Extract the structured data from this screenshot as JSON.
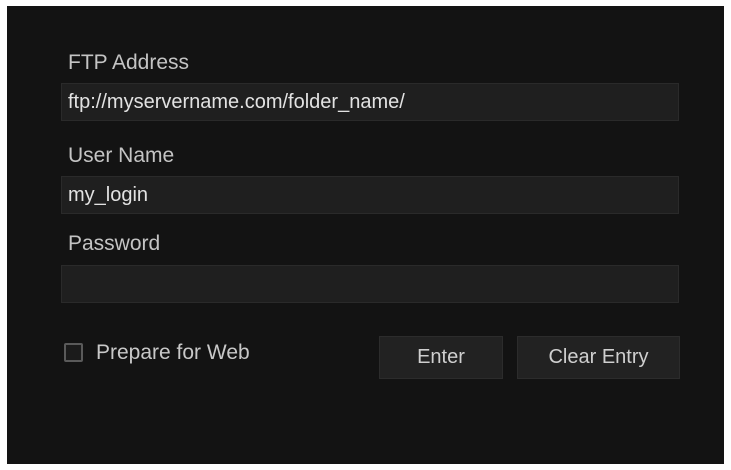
{
  "form": {
    "ftp_label": "FTP Address",
    "ftp_value": "ftp://myservername.com/folder_name/",
    "user_label": "User Name",
    "user_value": "my_login",
    "password_label": "Password",
    "password_value": "",
    "prepare_label": "Prepare for Web",
    "prepare_checked": false,
    "enter_label": "Enter",
    "clear_label": "Clear Entry"
  },
  "colors": {
    "panel_bg": "#131313",
    "field_bg": "#1f1f1f",
    "text": "#c8c8c8"
  }
}
